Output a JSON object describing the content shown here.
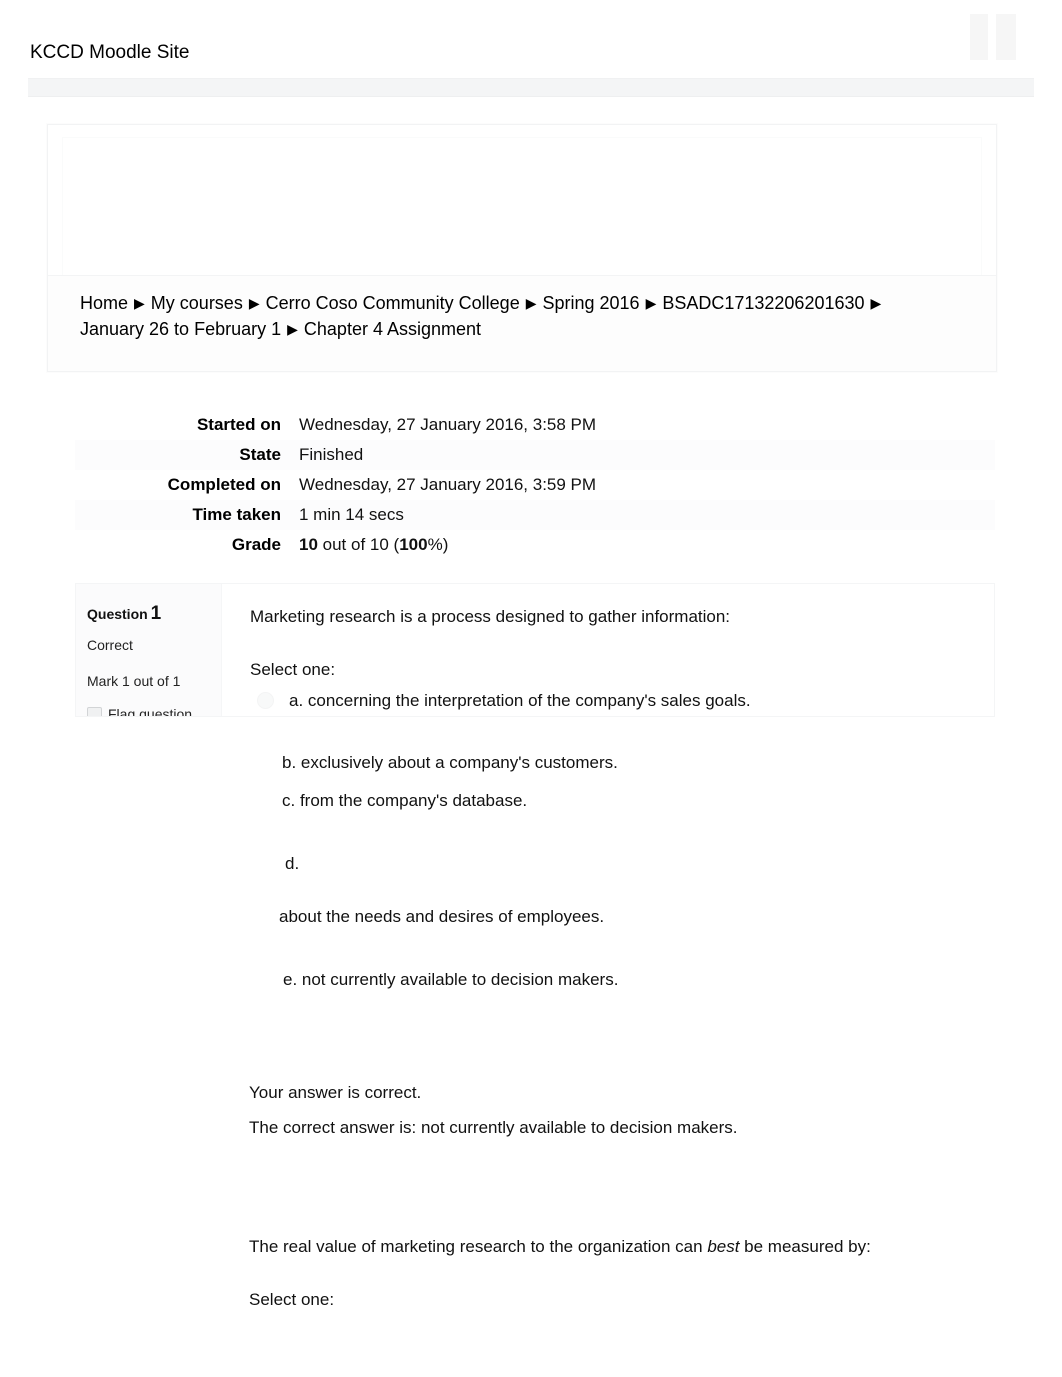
{
  "site": {
    "title": "KCCD Moodle Site"
  },
  "breadcrumb": {
    "separator": "▶",
    "items": [
      "Home",
      "My courses",
      "Cerro Coso Community College",
      "Spring 2016",
      "BSADC17132206201630",
      "January 26 to February 1",
      "Chapter 4 Assignment"
    ]
  },
  "summary": {
    "rows": [
      {
        "label": "Started on",
        "value": "Wednesday, 27 January 2016, 3:58 PM"
      },
      {
        "label": "State",
        "value": "Finished"
      },
      {
        "label": "Completed on",
        "value": "Wednesday, 27 January 2016, 3:59 PM"
      },
      {
        "label": "Time taken",
        "value": "1 min 14 secs"
      }
    ],
    "grade": {
      "label": "Grade",
      "score": "10",
      "middle": " out of 10 (",
      "percent": "100",
      "suffix": "%)"
    }
  },
  "question1": {
    "number_label": "Question",
    "number": "1",
    "state": "Correct",
    "mark": "Mark 1 out of 1",
    "flag_label": "Flag question",
    "text": "Marketing research is a process designed to gather information:",
    "select_one": "Select one:",
    "options": {
      "a": "a. concerning the interpretation of the company's sales goals.",
      "b": "b. exclusively about a company's customers.",
      "c": "c. from the company's database.",
      "d": "d.",
      "d_continued": "about the needs and desires of employees.",
      "e": "e. not currently available to decision makers."
    },
    "feedback_correct": "Your answer is correct.",
    "feedback_answer": "The correct answer is: not currently available to decision makers."
  },
  "question2": {
    "text_before": "The real value of marketing research to the organization can ",
    "text_emphasis": "best",
    "text_after": " be measured by:",
    "select_one": "Select one:"
  },
  "colors": {
    "page_background": "#ffffff",
    "text": "#111111",
    "card_border": "#f2f3f4",
    "info_panel": "#fbfbfc"
  }
}
